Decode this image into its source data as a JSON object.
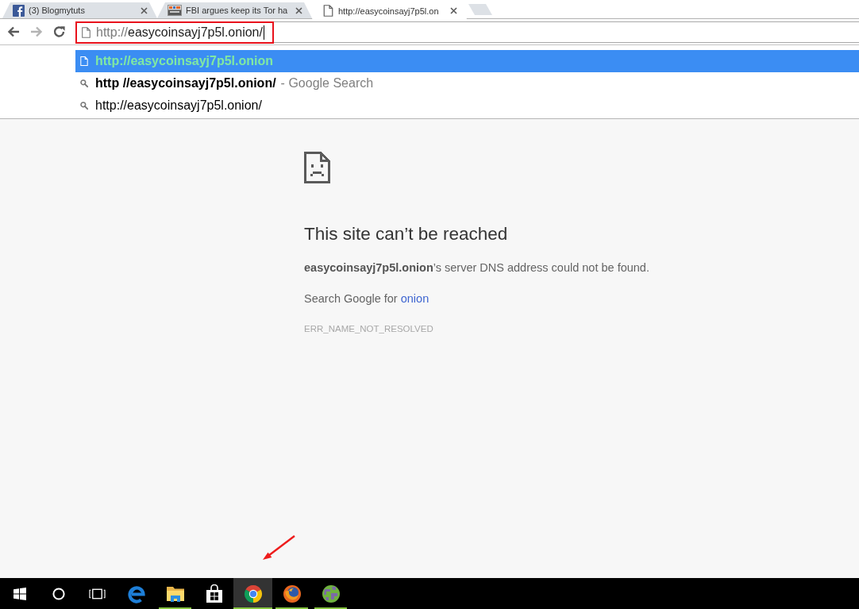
{
  "tabs": [
    {
      "title": "(3) Blogmytuts",
      "selected": false
    },
    {
      "title": "FBI argues keep its Tor ha",
      "selected": false
    },
    {
      "title": "http://easycoinsayj7p5l.on",
      "selected": true
    }
  ],
  "toolbar": {
    "nav_buttons": [
      {
        "disabled": false
      },
      {
        "disabled": true
      },
      {
        "disabled": false
      }
    ]
  },
  "address_bar": {
    "scheme": "http://",
    "host": "easycoinsayj7p5l.onion/",
    "focused": true,
    "highlighted": true
  },
  "suggestions": [
    {
      "kind": "url",
      "text": "http://easycoinsayj7p5l.onion",
      "bold": true,
      "selected": true
    },
    {
      "kind": "search",
      "text": "http //easycoinsayj7p5l.onion/",
      "description": "- Google Search",
      "bold": true,
      "selected": false
    },
    {
      "kind": "search",
      "text": "http://easycoinsayj7p5l.onion/",
      "bold": false,
      "selected": false
    }
  ],
  "error_page": {
    "title": "This site can’t be reached",
    "message": "**easycoinsayj7p5l.onion**’s server DNS address could not be found.",
    "search_prefix": "Search Google for",
    "search_link": "onion",
    "error_code": "ERR_NAME_NOT_RESOLVED"
  },
  "taskbar": {
    "apps": [
      {
        "running": false,
        "selected": false
      },
      {
        "running": true,
        "selected": false
      },
      {
        "running": false,
        "selected": false
      },
      {
        "running": true,
        "selected": true
      },
      {
        "running": true,
        "selected": false
      },
      {
        "running": true,
        "selected": false
      }
    ]
  },
  "annotations": {
    "taskbar_arrow": true
  }
}
